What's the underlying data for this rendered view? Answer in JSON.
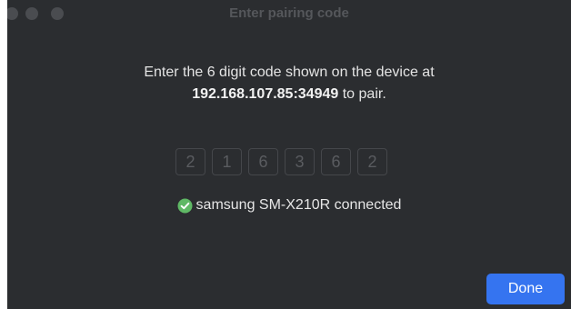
{
  "window": {
    "title": "Enter pairing code"
  },
  "message": {
    "line1": "Enter the 6 digit code shown on the device at",
    "address": "192.168.107.85:34949",
    "suffix": " to pair."
  },
  "code": {
    "digits": [
      "2",
      "1",
      "6",
      "3",
      "6",
      "2"
    ]
  },
  "status": {
    "icon": "check-circle-icon",
    "text": "samsung SM-X210R connected",
    "color": "#5fb865"
  },
  "actions": {
    "done_label": "Done",
    "accent": "#3574f0"
  }
}
